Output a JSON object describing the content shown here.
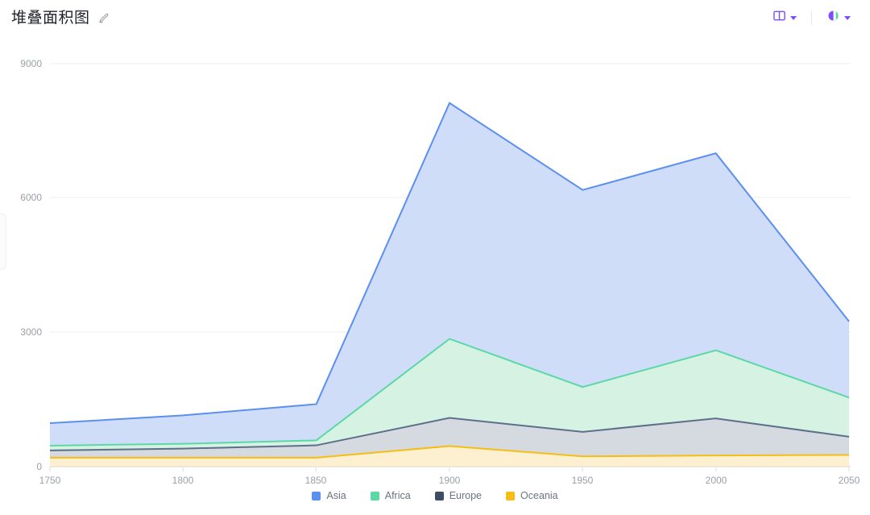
{
  "header": {
    "title": "堆叠面积图",
    "edit_icon": "pencil-edit-icon",
    "tools": [
      {
        "name": "layout-columns",
        "icon": "columns-layout-icon",
        "caret": "chevron-down-icon"
      },
      {
        "name": "color-theme",
        "icon": "color-palette-icon",
        "caret": "chevron-down-icon"
      }
    ]
  },
  "colors": {
    "accent": "#7c4dff",
    "asia_line": "#5b8ff0",
    "asia_fill": "#cfddf8",
    "africa_line": "#5ad8a6",
    "africa_fill": "#d6f2e3",
    "europe_line": "#5d6f8a",
    "europe_fill": "#d5d9e0",
    "oceania_line": "#f6bd16",
    "oceania_fill": "#fdf0d0",
    "grid": "#ededf0",
    "axis_text": "#9aa0a6",
    "title_text": "#1f2329"
  },
  "chart_data": {
    "type": "area",
    "stacked": true,
    "title": "堆叠面积图",
    "xlabel": "",
    "ylabel": "",
    "x": [
      1750,
      1800,
      1850,
      1900,
      1950,
      2000,
      2050
    ],
    "xticks": [
      "1750",
      "1800",
      "1850",
      "1900",
      "1950",
      "2000",
      "2050"
    ],
    "yticks": [
      "0",
      "3000",
      "6000",
      "9000"
    ],
    "xlim": [
      1750,
      2050
    ],
    "ylim": [
      0,
      9000
    ],
    "grid": true,
    "legend_position": "bottom",
    "series": [
      {
        "name": "Asia",
        "color": "#5b8ff0",
        "fill": "#cfddf8",
        "values": [
          502,
          635,
          809,
          5268,
          4400,
          4400,
          1700
        ]
      },
      {
        "name": "Africa",
        "color": "#5ad8a6",
        "fill": "#d6f2e3",
        "values": [
          106,
          107,
          111,
          1766,
          1002,
          1522,
          875
        ]
      },
      {
        "name": "Europe",
        "color": "#5d6f8a",
        "fill": "#d5d9e0",
        "values": [
          163,
          203,
          276,
          628,
          547,
          827,
          408
        ]
      },
      {
        "name": "Oceania",
        "color": "#f6bd16",
        "fill": "#fdf0d0",
        "values": [
          200,
          200,
          200,
          460,
          230,
          250,
          260
        ]
      }
    ],
    "stack_tops": {
      "Oceania": [
        200,
        200,
        200,
        460,
        230,
        250,
        260
      ],
      "Europe": [
        363,
        403,
        476,
        1088,
        777,
        1077,
        668
      ],
      "Africa": [
        469,
        510,
        587,
        2854,
        1779,
        2599,
        1543
      ],
      "Asia": [
        971,
        1145,
        1396,
        8122,
        6179,
        6999,
        3243
      ]
    }
  },
  "legend": {
    "items": [
      {
        "label": "Asia",
        "color": "#5b8ff0"
      },
      {
        "label": "Africa",
        "color": "#5ad8a6"
      },
      {
        "label": "Europe",
        "color": "#3d4d66"
      },
      {
        "label": "Oceania",
        "color": "#f6bd16"
      }
    ]
  }
}
